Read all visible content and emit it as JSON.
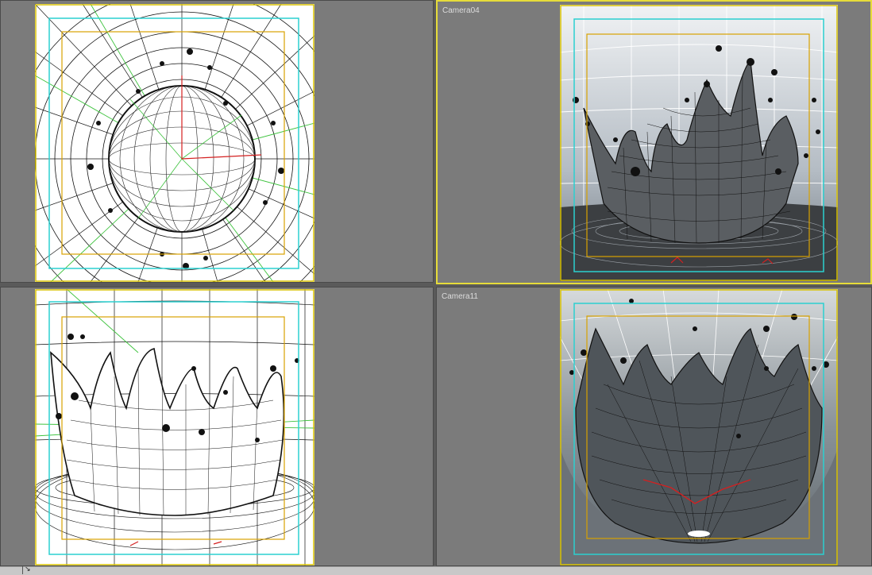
{
  "viewports": {
    "top_left": {
      "label": "",
      "active": false
    },
    "top_right": {
      "label": "Camera04",
      "active": true
    },
    "bottom_left": {
      "label": "",
      "active": false
    },
    "bottom_right": {
      "label": "Camera11",
      "active": false
    }
  },
  "colors": {
    "viewport_bg": "#7b7b7b",
    "active_border": "#e6dc3a",
    "safe_frame_outer": "#d8c200",
    "safe_frame_action": "#2bd0d0",
    "safe_frame_title": "#d8a200",
    "wire_white": "#ffffff",
    "wire_black": "#0a0a0a",
    "wire_green": "#3cc23c",
    "wire_red": "#d42020"
  },
  "status": {
    "corner_glyph": "↘"
  }
}
